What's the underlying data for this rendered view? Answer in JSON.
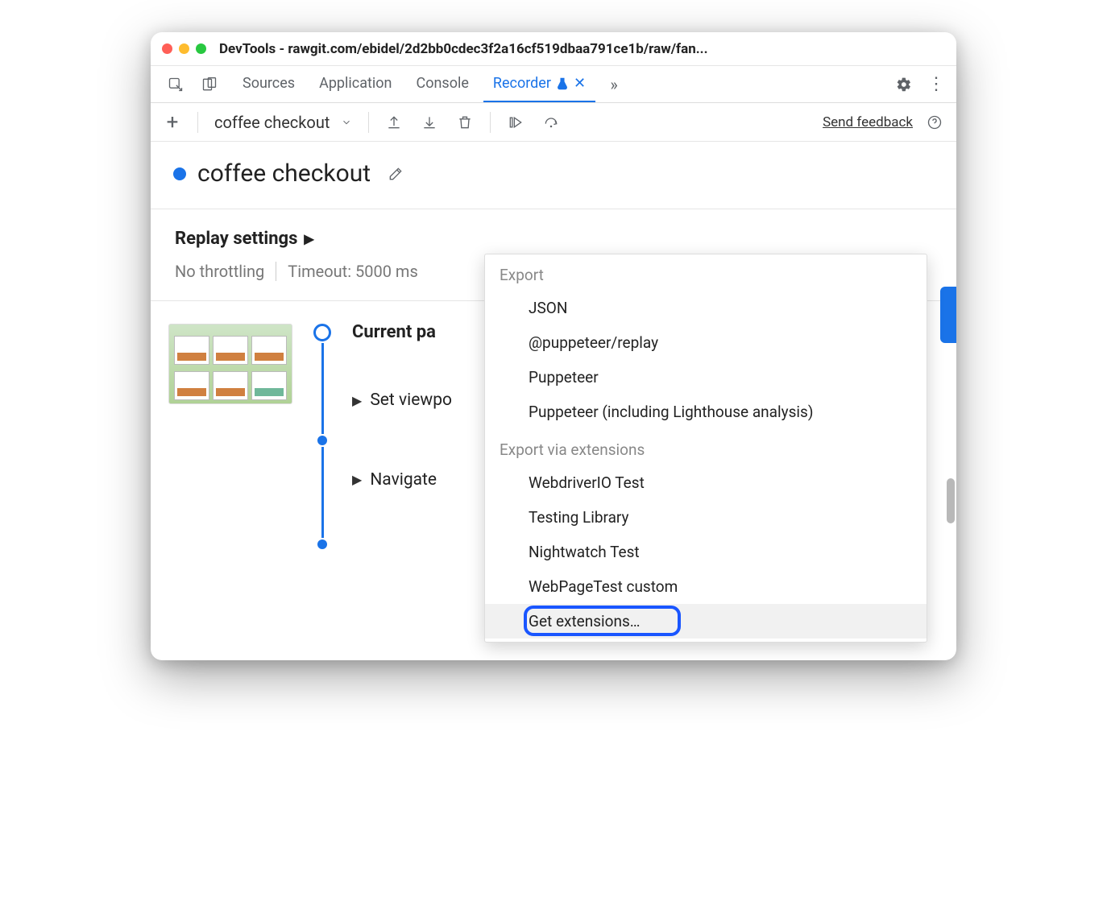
{
  "window": {
    "title": "DevTools - rawgit.com/ebidel/2d2bb0cdec3f2a16cf519dbaa791ce1b/raw/fan..."
  },
  "tabs": {
    "items": [
      "Sources",
      "Application",
      "Console",
      "Recorder"
    ],
    "activeIndex": 3
  },
  "toolbar": {
    "recordingName": "coffee checkout",
    "sendFeedback": "Send feedback"
  },
  "recorder": {
    "title": "coffee checkout",
    "replaySettingsLabel": "Replay settings",
    "throttling": "No throttling",
    "timeout": "Timeout: 5000 ms"
  },
  "steps": {
    "current": "Current pa",
    "items": [
      "Set viewpo",
      "Navigate"
    ]
  },
  "exportMenu": {
    "label1": "Export",
    "group1": [
      "JSON",
      "@puppeteer/replay",
      "Puppeteer",
      "Puppeteer (including Lighthouse analysis)"
    ],
    "label2": "Export via extensions",
    "group2": [
      "WebdriverIO Test",
      "Testing Library",
      "Nightwatch Test",
      "WebPageTest custom",
      "Get extensions…"
    ],
    "highlighted": "Get extensions…"
  }
}
